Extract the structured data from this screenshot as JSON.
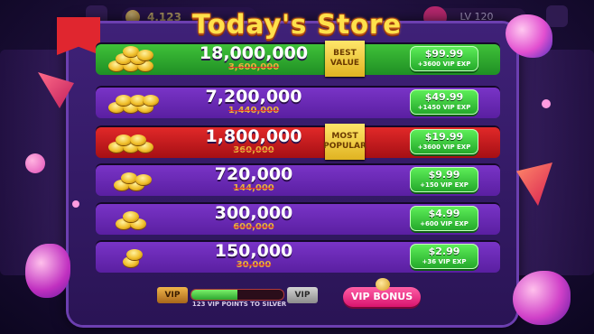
{
  "header": {
    "title": "Today's Store",
    "coin_balance": "4,123",
    "level": "LV 120"
  },
  "rows": [
    {
      "amount": "18,000,000",
      "old": "3,600,000",
      "tag": "BEST VALUE",
      "price": "$99.99",
      "bonus": "+3600 VIP EXP",
      "color": "green"
    },
    {
      "amount": "7,200,000",
      "old": "1,440,000",
      "tag": "",
      "price": "$49.99",
      "bonus": "+1450 VIP EXP",
      "color": "purple"
    },
    {
      "amount": "1,800,000",
      "old": "360,000",
      "tag": "MOST POPULAR",
      "price": "$19.99",
      "bonus": "+3600 VIP EXP",
      "color": "red"
    },
    {
      "amount": "720,000",
      "old": "144,000",
      "tag": "",
      "price": "$9.99",
      "bonus": "+150 VIP EXP",
      "color": "purple"
    },
    {
      "amount": "300,000",
      "old": "600,000",
      "tag": "",
      "price": "$4.99",
      "bonus": "+600 VIP EXP",
      "color": "purple"
    },
    {
      "amount": "150,000",
      "old": "30,000",
      "tag": "",
      "price": "$2.99",
      "bonus": "+36 VIP EXP",
      "color": "purple"
    }
  ],
  "vip": {
    "left_badge": "VIP",
    "right_badge": "VIP",
    "progress": 0.5,
    "points_text": "123 VIP POINTS TO SILVER",
    "bonus_button": "VIP BONUS"
  },
  "colors": {
    "title": "#ffe14b",
    "buy_button": "#3fd13a",
    "panel": "#3f2178"
  }
}
